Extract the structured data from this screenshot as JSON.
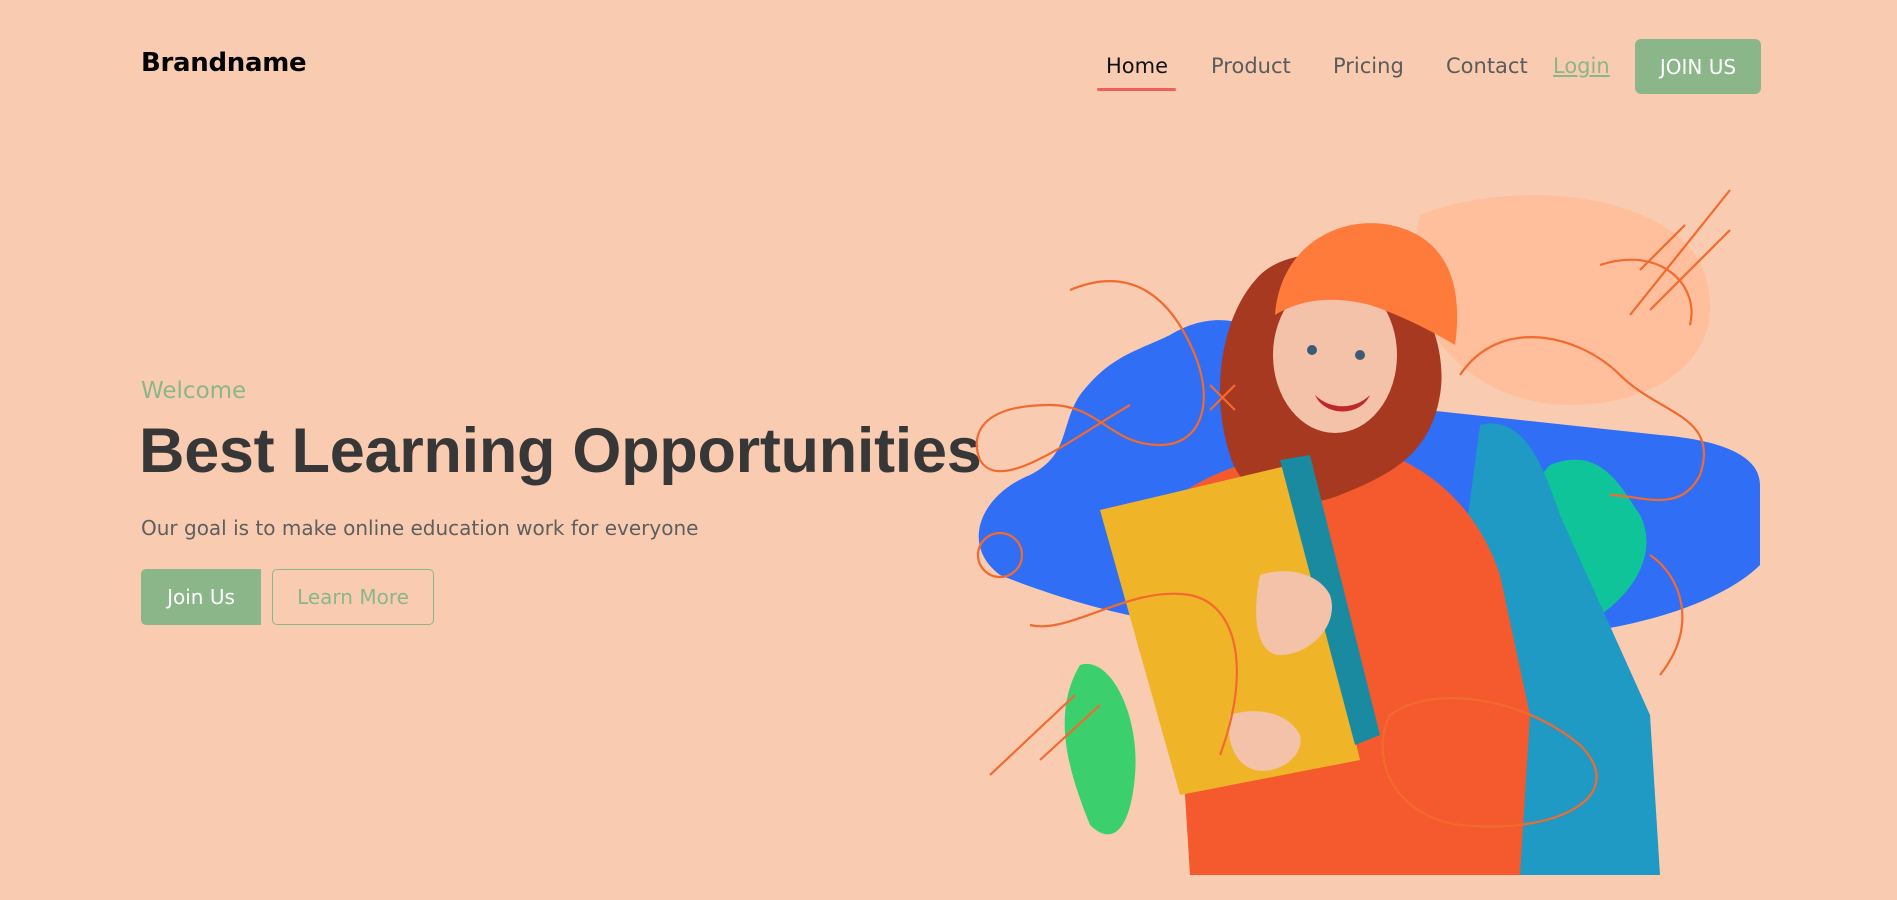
{
  "header": {
    "brand": "Brandname",
    "nav": [
      {
        "label": "Home",
        "active": true
      },
      {
        "label": "Product",
        "active": false
      },
      {
        "label": "Pricing",
        "active": false
      },
      {
        "label": "Contact",
        "active": false
      }
    ],
    "login_label": "Login",
    "cta_label": "JOIN US"
  },
  "hero": {
    "eyebrow": "Welcome",
    "title": "Best Learning Opportunities",
    "subtitle": "Our goal is to make online education work for everyone",
    "primary_button": "Join Us",
    "secondary_button": "Learn More"
  },
  "colors": {
    "background": "#f9ccb1",
    "accent_green": "#8bb68a",
    "nav_underline": "#f0605a",
    "headline": "#373737",
    "blob_blue": "#2f6ef5",
    "blob_teal": "#10c49a",
    "line_orange": "#f26a2e"
  }
}
